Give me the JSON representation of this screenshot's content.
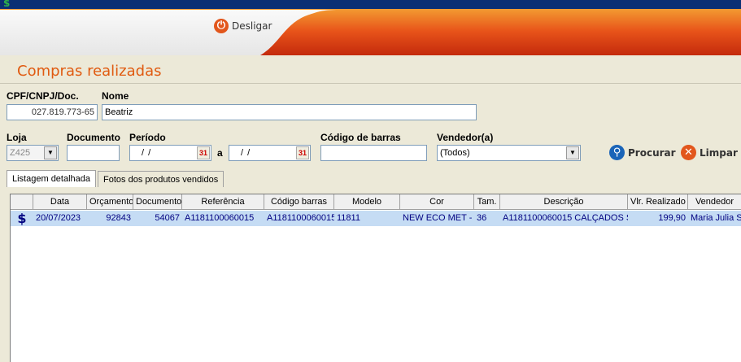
{
  "top": {
    "icon": "dollar-icon"
  },
  "header": {
    "logoff_label": "Desligar",
    "logoff_icon": "power-icon",
    "accent": "#e2561c"
  },
  "title": "Compras realizadas",
  "customer": {
    "doc_label": "CPF/CNPJ/Doc.",
    "doc_value": "027.819.773-65",
    "name_label": "Nome",
    "name_value": "Beatriz"
  },
  "filters": {
    "loja_label": "Loja",
    "loja_value": "Z425",
    "documento_label": "Documento",
    "documento_value": "",
    "periodo_label": "Período",
    "periodo_from": "/ /",
    "periodo_sep": "a",
    "periodo_to": "/ /",
    "barcode_label": "Código de barras",
    "barcode_value": "",
    "vendedor_label": "Vendedor(a)",
    "vendedor_value": "(Todos)"
  },
  "buttons": {
    "search_label": "Procurar",
    "clear_label": "Limpar"
  },
  "tabs": [
    "Listagem detalhada",
    "Fotos dos produtos vendidos"
  ],
  "grid": {
    "columns": [
      "",
      "Data",
      "Orçamento",
      "Documento",
      "Referência",
      "Código barras",
      "Modelo",
      "Cor",
      "Tam.",
      "Descrição",
      "Vlr. Realizado",
      "Vendedor"
    ],
    "rows": [
      [
        "$",
        "20/07/2023",
        "92843",
        "54067",
        "A1181100060015",
        "A1181100060015",
        "11811",
        "NEW ECO MET -",
        "36",
        "A1181100060015 CALÇADOS S",
        "199,90",
        "Maria Julia S"
      ]
    ]
  }
}
